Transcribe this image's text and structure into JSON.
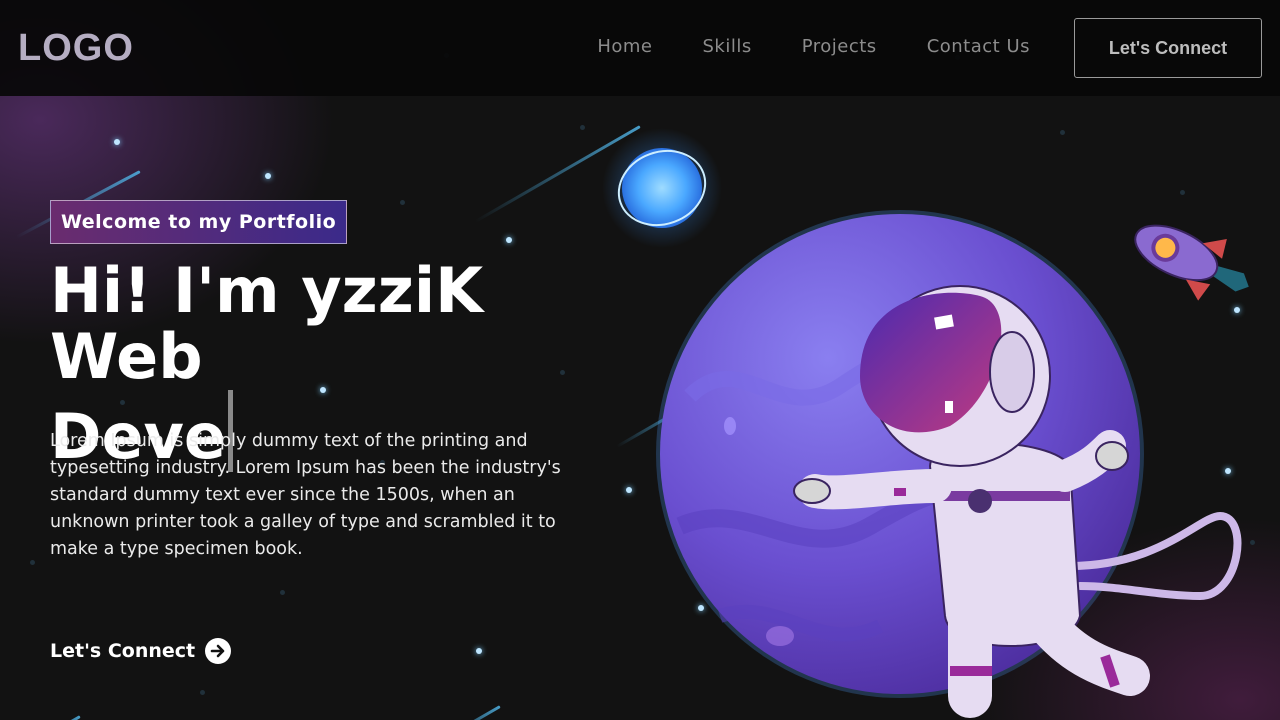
{
  "nav": {
    "logo": "LOGO",
    "links": [
      "Home",
      "Skills",
      "Projects",
      "Contact Us"
    ],
    "cta_label": "Let's Connect"
  },
  "hero": {
    "tagline": "Welcome to my Portfolio",
    "headline_line1": "Hi! I'm yzziK Web",
    "headline_line2": "Deve",
    "intro": "Lorem Ipsum is simply dummy text of the printing and typesetting industry. Lorem Ipsum has been the industry's standard dummy text ever since the 1500s, when an unknown printer took a galley of type and scrambled it to make a type specimen book.",
    "cta_label": "Let's Connect"
  },
  "icons": {
    "cta": "arrow-right-circle-icon",
    "illustration": "astronaut-planet-illustration",
    "rocket": "rocket-icon",
    "glow_planet": "blue-planet-icon"
  },
  "colors": {
    "background": "#121212",
    "navbar": "#080808",
    "tagline_gradient_start": "#6a2c6e",
    "tagline_gradient_end": "#3b2a8a",
    "planet": "#6a4fd0",
    "accent_blue": "#5fb8ff"
  }
}
